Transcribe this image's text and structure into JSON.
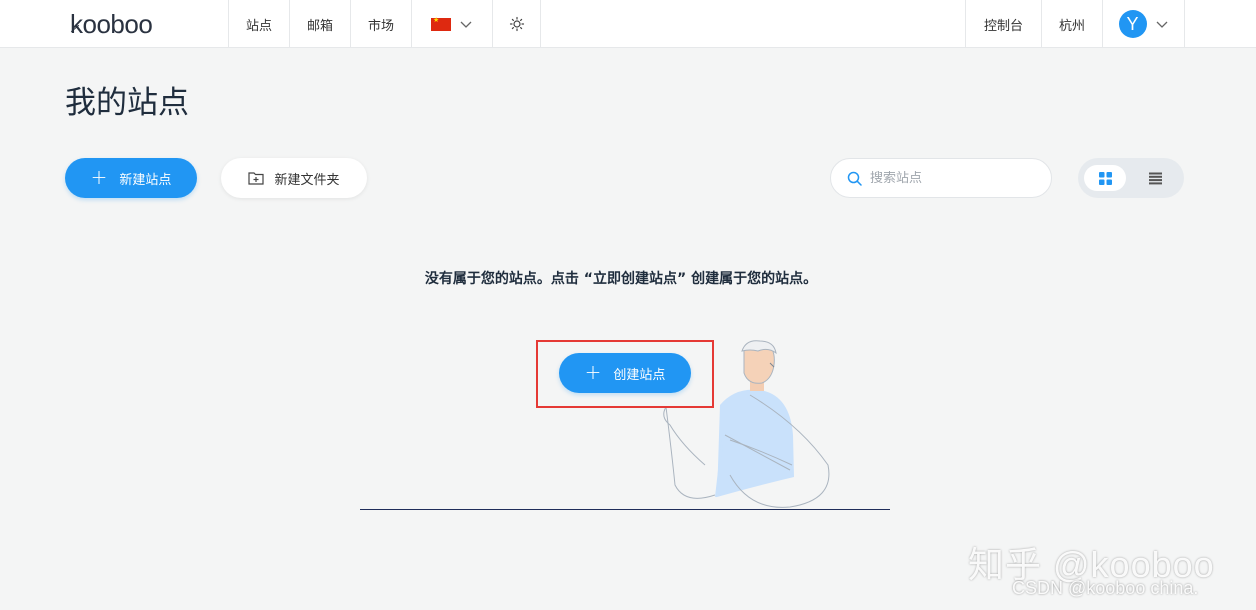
{
  "header": {
    "logo": "kooboo",
    "nav": [
      "站点",
      "邮箱",
      "市场"
    ],
    "language_icon": "china-flag-icon",
    "theme_icon": "sun-icon",
    "console": "控制台",
    "region": "杭州",
    "avatar_initial": "Y"
  },
  "page": {
    "title": "我的站点",
    "new_site_label": "新建站点",
    "new_folder_label": "新建文件夹",
    "search_placeholder": "搜索站点",
    "empty_message": "没有属于您的站点。点击 “立即创建站点” 创建属于您的站点。",
    "create_site_label": "创建站点"
  },
  "watermark": {
    "main": "知乎 @kooboo",
    "sub": "CSDN @kooboo china."
  },
  "colors": {
    "accent": "#2196f3",
    "highlight": "#e53935",
    "background": "#f4f5f5"
  }
}
